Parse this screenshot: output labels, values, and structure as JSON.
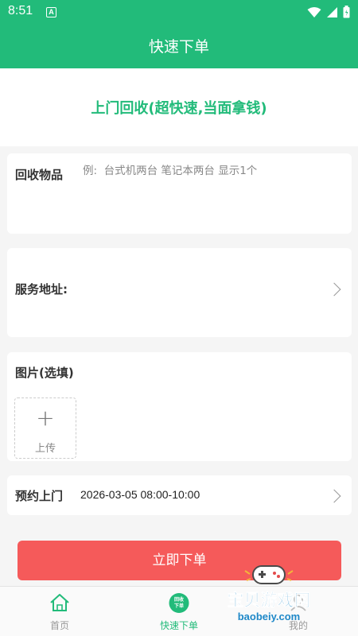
{
  "status_bar": {
    "time": "8:51",
    "notification_glyph": "A",
    "icons": [
      "wifi-icon",
      "signal-icon",
      "battery-icon"
    ]
  },
  "header": {
    "title": "快速下单"
  },
  "banner": {
    "text": "上门回收(超快速,当面拿钱)"
  },
  "form": {
    "items_label": "回收物品",
    "items_value": "",
    "items_placeholder": "例:  台式机两台 笔记本两台 显示1个",
    "address_label": "服务地址:",
    "photo_label": "图片(选填)",
    "upload_label": "上传",
    "appointment_label": "预约上门",
    "appointment_value": "2026-03-05 08:00-10:00"
  },
  "submit_label": "立即下单",
  "tabs": [
    {
      "label": "首页",
      "icon": "home-icon",
      "active": false
    },
    {
      "label": "快速下单",
      "icon": "recycle-order-icon",
      "badge": "回收\n下单",
      "active": true
    },
    {
      "label": "我的",
      "icon": "profile-icon",
      "active": false
    }
  ],
  "watermark": {
    "title": "宝贝游戏网",
    "url": "baobeiy.com"
  },
  "colors": {
    "primary": "#22bb7a",
    "submit": "#f55a5a",
    "background": "#f5f5f5"
  }
}
